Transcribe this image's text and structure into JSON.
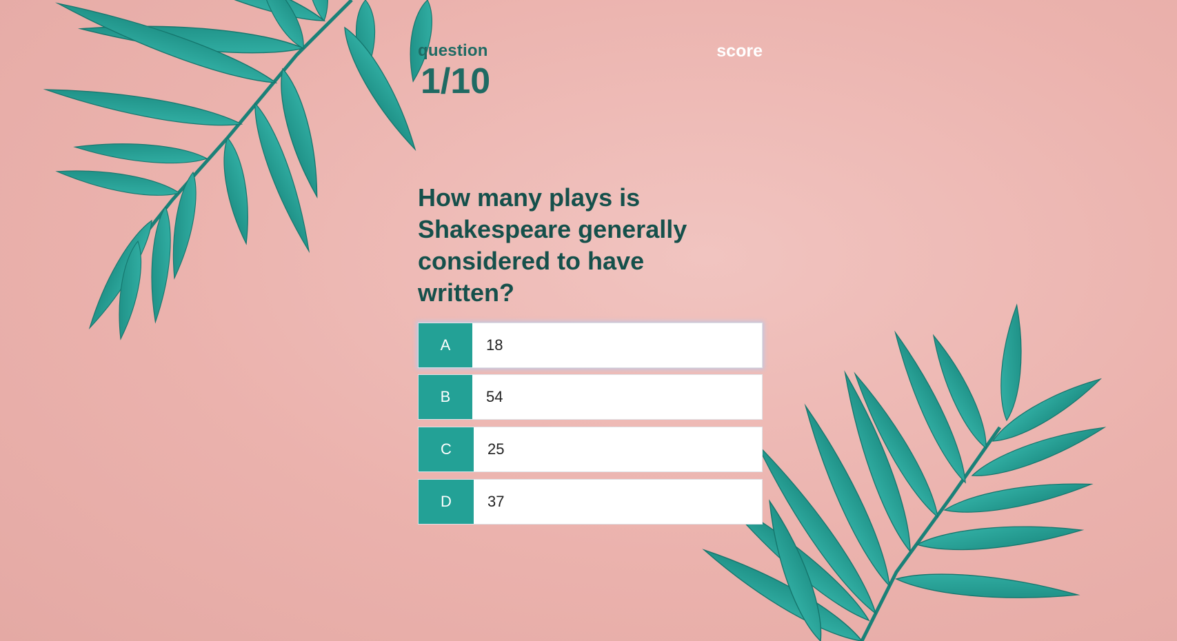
{
  "hud": {
    "question_label": "question",
    "question_counter": "1/10",
    "score_label": "score"
  },
  "question": {
    "text": "How many plays is Shakespeare generally considered to have written?"
  },
  "answers": [
    {
      "letter": "A",
      "text": "18"
    },
    {
      "letter": "B",
      "text": "54"
    },
    {
      "letter": "C",
      "text": "25"
    },
    {
      "letter": "D",
      "text": "37"
    }
  ],
  "colors": {
    "background": "#ebb2ad",
    "accent": "#23a196",
    "heading": "#15504b",
    "leaf": "#2aa59a"
  },
  "decor": {
    "background_image": "teal-leaves-on-pink"
  }
}
